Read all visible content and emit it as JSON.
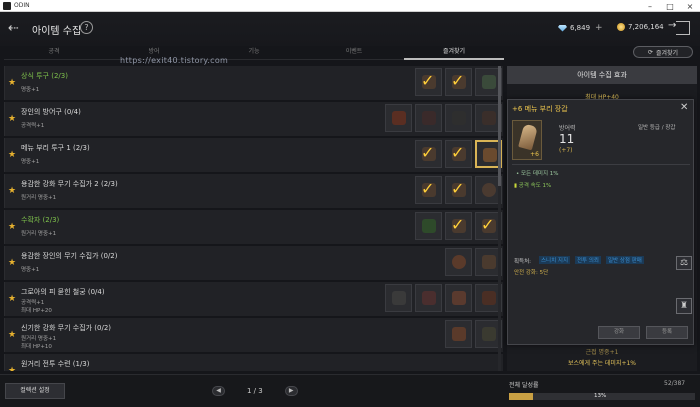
{
  "window": {
    "app_title": "ODIN"
  },
  "header": {
    "title": "아이템 수집",
    "diamond_amount": "6,849",
    "gold_amount": "7,206,164"
  },
  "tabs": [
    "공격",
    "방어",
    "기능",
    "이벤트",
    "즐겨찾기"
  ],
  "reset_button": "즐겨찾기",
  "watermark": "https://exit40.tistory.com",
  "rows": [
    {
      "title": "상식 투구 (2/3)",
      "green": true,
      "rewards": [
        "명중+1"
      ]
    },
    {
      "title": "장인의 방어구 (0/4)",
      "green": false,
      "rewards": [
        "공격력+1"
      ]
    },
    {
      "title": "메뉴 부리 투구 1 (2/3)",
      "green": false,
      "rewards": [
        "명중+1"
      ]
    },
    {
      "title": "용감한 강화 무기 수집가 2 (2/3)",
      "green": false,
      "rewards": [
        "원거리 명중+1"
      ]
    },
    {
      "title": "수확자 (2/3)",
      "green": true,
      "rewards": [
        "원거리 명중+1"
      ]
    },
    {
      "title": "용감한 장인의 무기 수집가 (0/2)",
      "green": false,
      "rewards": [
        "명중+1"
      ]
    },
    {
      "title": "그로아의 피 묻힌 철궁 (0/4)",
      "green": false,
      "rewards": [
        "공격력+1",
        "최대 HP+20"
      ]
    },
    {
      "title": "신기한 강화 무기 수집가 (0/2)",
      "green": false,
      "rewards": [
        "원거리 명중+1",
        "최대 HP+10"
      ]
    },
    {
      "title": "원거리 전투 수련 (1/3)",
      "green": false,
      "rewards": []
    }
  ],
  "bottom": {
    "title_button": "컬렉션 설정",
    "page": "1 / 3",
    "progress_label": "전체 달성률",
    "progress_count": "52/387",
    "progress_percent": "13%",
    "progress_value": 0.13
  },
  "effects": {
    "header": "아이템 수집 효과",
    "lines": [
      "최대 HP+40",
      "근접 명중+1",
      "보스에게 주는 데미지+1%"
    ]
  },
  "popup": {
    "title_prefix": "+6",
    "title_name": "메뉴 부리 장갑",
    "stat_label": "방어력",
    "stat_value": "11",
    "stat_plus": "(+7)",
    "item_level": "+6",
    "grade": "일반 등급 / 장갑",
    "option1": "• 모든 데미지 1%",
    "option2": "공격 속도 1%",
    "source_label": "획득처:",
    "source_links": [
      "스니치 지지",
      "전투 의뢰",
      "일반 상점 판매"
    ],
    "source_extra": "안전 강화: 5단",
    "buttons": [
      "강화",
      "등록"
    ]
  }
}
